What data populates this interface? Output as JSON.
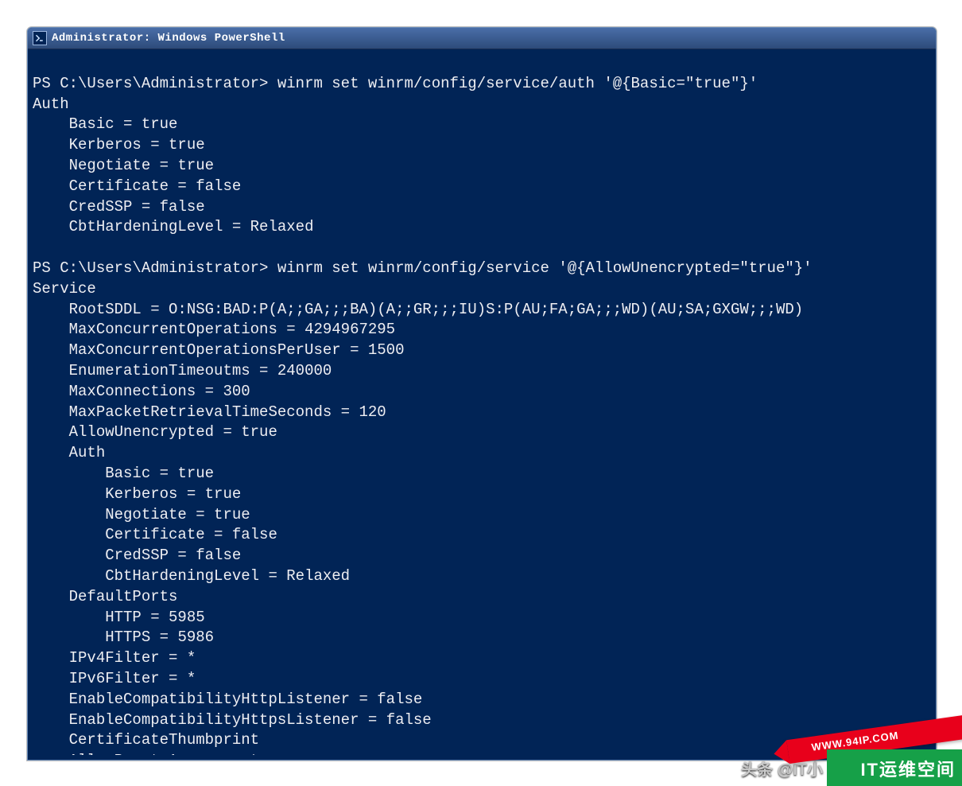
{
  "window": {
    "title": "Administrator: Windows PowerShell"
  },
  "terminal": {
    "prompt": "PS C:\\Users\\Administrator>",
    "cmd1": "winrm set winrm/config/service/auth '@{Basic=\"true\"}'",
    "out1_header": "Auth",
    "out1": {
      "Basic": "true",
      "Kerberos": "true",
      "Negotiate": "true",
      "Certificate": "false",
      "CredSSP": "false",
      "CbtHardeningLevel": "Relaxed"
    },
    "cmd2": "winrm set winrm/config/service '@{AllowUnencrypted=\"true\"}'",
    "out2_header": "Service",
    "out2": {
      "RootSDDL": "O:NSG:BAD:P(A;;GA;;;BA)(A;;GR;;;IU)S:P(AU;FA;GA;;;WD)(AU;SA;GXGW;;;WD)",
      "MaxConcurrentOperations": "4294967295",
      "MaxConcurrentOperationsPerUser": "1500",
      "EnumerationTimeoutms": "240000",
      "MaxConnections": "300",
      "MaxPacketRetrievalTimeSeconds": "120",
      "AllowUnencrypted": "true",
      "Auth": {
        "Basic": "true",
        "Kerberos": "true",
        "Negotiate": "true",
        "Certificate": "false",
        "CredSSP": "false",
        "CbtHardeningLevel": "Relaxed"
      },
      "DefaultPorts": {
        "HTTP": "5985",
        "HTTPS": "5986"
      },
      "IPv4Filter": "*",
      "IPv6Filter": "*",
      "EnableCompatibilityHttpListener": "false",
      "EnableCompatibilityHttpsListener": "false",
      "CertificateThumbprint": "",
      "AllowRemoteAccess": "true"
    }
  },
  "overlay": {
    "url": "WWW.94IP.COM",
    "site": "IT运维空间",
    "author": "头条 @IT小"
  }
}
